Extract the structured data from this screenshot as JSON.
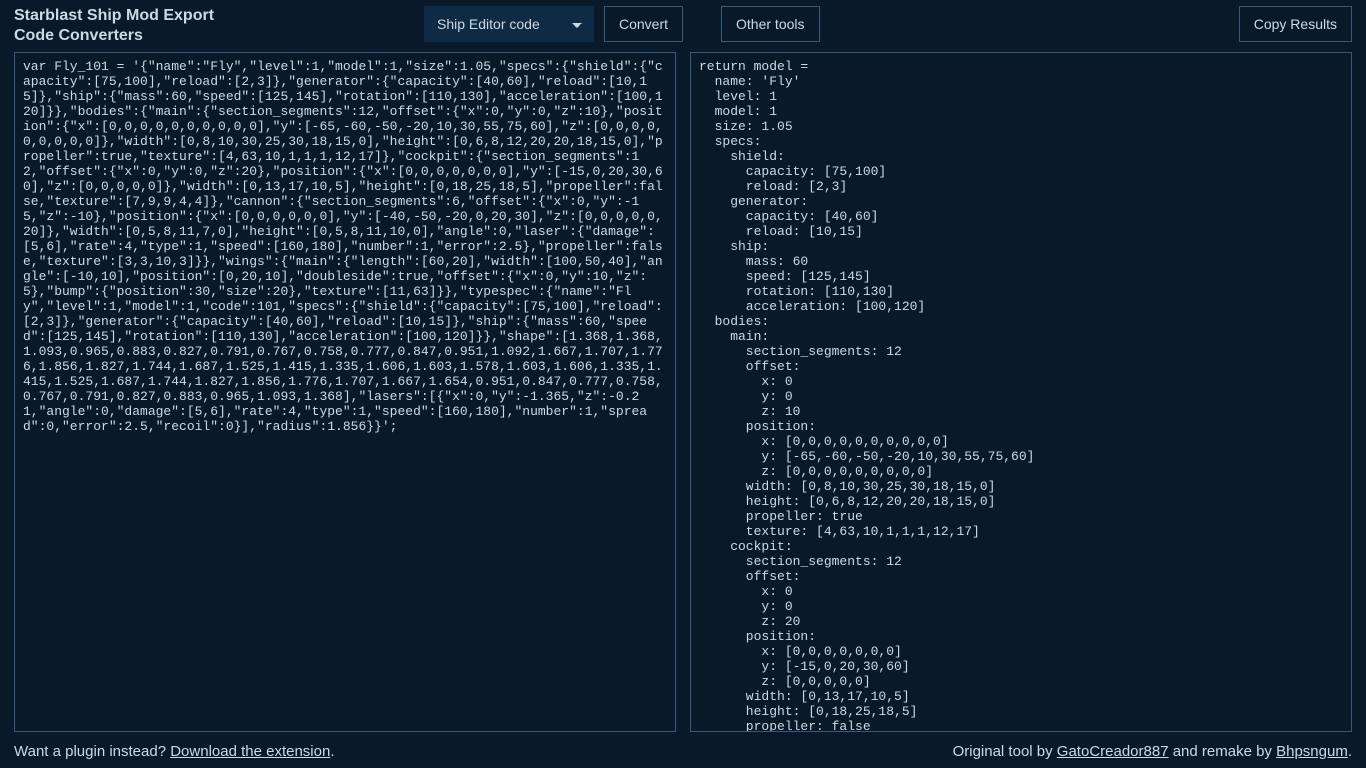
{
  "header": {
    "title_line1": "Starblast Ship Mod Export",
    "title_line2": "Code Converters",
    "codetype_selected": "Ship Editor code",
    "convert_label": "Convert",
    "other_tools_label": "Other tools",
    "copy_results_label": "Copy Results"
  },
  "input_code": "var Fly_101 = '{\"name\":\"Fly\",\"level\":1,\"model\":1,\"size\":1.05,\"specs\":{\"shield\":{\"capacity\":[75,100],\"reload\":[2,3]},\"generator\":{\"capacity\":[40,60],\"reload\":[10,15]},\"ship\":{\"mass\":60,\"speed\":[125,145],\"rotation\":[110,130],\"acceleration\":[100,120]}},\"bodies\":{\"main\":{\"section_segments\":12,\"offset\":{\"x\":0,\"y\":0,\"z\":10},\"position\":{\"x\":[0,0,0,0,0,0,0,0,0,0],\"y\":[-65,-60,-50,-20,10,30,55,75,60],\"z\":[0,0,0,0,0,0,0,0,0]},\"width\":[0,8,10,30,25,30,18,15,0],\"height\":[0,6,8,12,20,20,18,15,0],\"propeller\":true,\"texture\":[4,63,10,1,1,1,12,17]},\"cockpit\":{\"section_segments\":12,\"offset\":{\"x\":0,\"y\":0,\"z\":20},\"position\":{\"x\":[0,0,0,0,0,0,0],\"y\":[-15,0,20,30,60],\"z\":[0,0,0,0,0]},\"width\":[0,13,17,10,5],\"height\":[0,18,25,18,5],\"propeller\":false,\"texture\":[7,9,9,4,4]},\"cannon\":{\"section_segments\":6,\"offset\":{\"x\":0,\"y\":-15,\"z\":-10},\"position\":{\"x\":[0,0,0,0,0,0],\"y\":[-40,-50,-20,0,20,30],\"z\":[0,0,0,0,0,20]},\"width\":[0,5,8,11,7,0],\"height\":[0,5,8,11,10,0],\"angle\":0,\"laser\":{\"damage\":[5,6],\"rate\":4,\"type\":1,\"speed\":[160,180],\"number\":1,\"error\":2.5},\"propeller\":false,\"texture\":[3,3,10,3]}},\"wings\":{\"main\":{\"length\":[60,20],\"width\":[100,50,40],\"angle\":[-10,10],\"position\":[0,20,10],\"doubleside\":true,\"offset\":{\"x\":0,\"y\":10,\"z\":5},\"bump\":{\"position\":30,\"size\":20},\"texture\":[11,63]}},\"typespec\":{\"name\":\"Fly\",\"level\":1,\"model\":1,\"code\":101,\"specs\":{\"shield\":{\"capacity\":[75,100],\"reload\":[2,3]},\"generator\":{\"capacity\":[40,60],\"reload\":[10,15]},\"ship\":{\"mass\":60,\"speed\":[125,145],\"rotation\":[110,130],\"acceleration\":[100,120]}},\"shape\":[1.368,1.368,1.093,0.965,0.883,0.827,0.791,0.767,0.758,0.777,0.847,0.951,1.092,1.667,1.707,1.776,1.856,1.827,1.744,1.687,1.525,1.415,1.335,1.606,1.603,1.578,1.603,1.606,1.335,1.415,1.525,1.687,1.744,1.827,1.856,1.776,1.707,1.667,1.654,0.951,0.847,0.777,0.758,0.767,0.791,0.827,0.883,0.965,1.093,1.368],\"lasers\":[{\"x\":0,\"y\":-1.365,\"z\":-0.21,\"angle\":0,\"damage\":[5,6],\"rate\":4,\"type\":1,\"speed\":[160,180],\"number\":1,\"spread\":0,\"error\":2.5,\"recoil\":0}],\"radius\":1.856}}';",
  "output_code": "return model =\n  name: 'Fly'\n  level: 1\n  model: 1\n  size: 1.05\n  specs:\n    shield:\n      capacity: [75,100]\n      reload: [2,3]\n    generator:\n      capacity: [40,60]\n      reload: [10,15]\n    ship:\n      mass: 60\n      speed: [125,145]\n      rotation: [110,130]\n      acceleration: [100,120]\n  bodies:\n    main:\n      section_segments: 12\n      offset:\n        x: 0\n        y: 0\n        z: 10\n      position:\n        x: [0,0,0,0,0,0,0,0,0,0]\n        y: [-65,-60,-50,-20,10,30,55,75,60]\n        z: [0,0,0,0,0,0,0,0,0]\n      width: [0,8,10,30,25,30,18,15,0]\n      height: [0,6,8,12,20,20,18,15,0]\n      propeller: true\n      texture: [4,63,10,1,1,1,12,17]\n    cockpit:\n      section_segments: 12\n      offset:\n        x: 0\n        y: 0\n        z: 20\n      position:\n        x: [0,0,0,0,0,0,0]\n        y: [-15,0,20,30,60]\n        z: [0,0,0,0,0]\n      width: [0,13,17,10,5]\n      height: [0,18,25,18,5]\n      propeller: false\n",
  "footer": {
    "plugin_text_prefix": "Want a plugin instead? ",
    "plugin_link_text": "Download the extension",
    "plugin_text_suffix": ".",
    "credits_prefix": "Original tool by ",
    "credits_author1": "GatoCreador887",
    "credits_mid": " and remake by ",
    "credits_author2": "Bhpsngum",
    "credits_suffix": "."
  }
}
